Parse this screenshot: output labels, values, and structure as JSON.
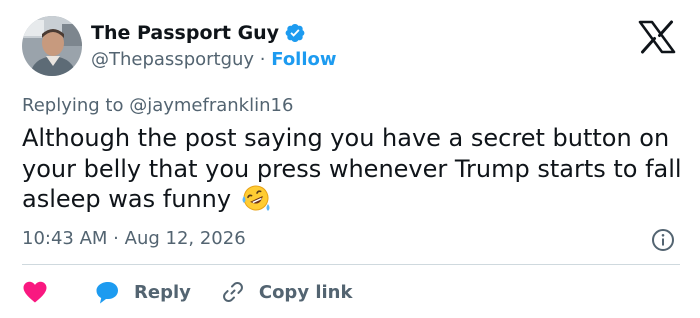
{
  "author": {
    "display_name": "The Passport Guy",
    "handle": "@Thepassportguy",
    "separator": " · ",
    "follow_label": "Follow",
    "verified_icon": "verified-badge-icon"
  },
  "reply_context": {
    "prefix": "Replying to ",
    "handle": "@jaymefranklin16"
  },
  "tweet": {
    "text": "Although the post saying you have a secret button on your belly that you press whenever Trump starts to fall asleep was funny ",
    "emoji": "rolling-on-floor-laughing-emoji"
  },
  "meta": {
    "time": "10:43 AM",
    "separator": " · ",
    "date": "Aug 12, 2026"
  },
  "actions": {
    "like_icon": "heart-icon",
    "reply_label": "Reply",
    "copy_link_label": "Copy link"
  },
  "colors": {
    "text": "#0f1419",
    "secondary": "#536471",
    "accent": "#1d9bf0",
    "like": "#f91880",
    "divider": "#cfd9de"
  }
}
